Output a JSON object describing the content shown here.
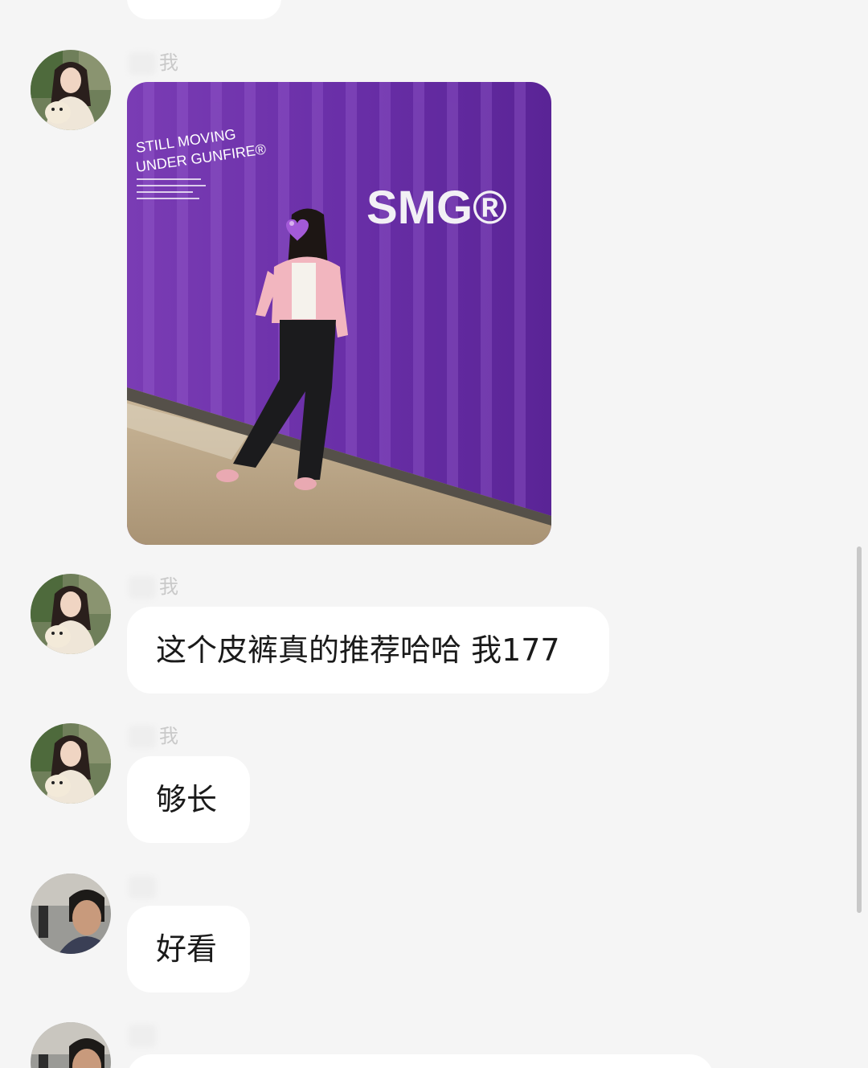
{
  "messages": [
    {
      "type": "image",
      "sender_name_suffix": "我",
      "image": {
        "wall_text_line1": "STILL MOVING",
        "wall_text_line2": "UNDER GUNFIRE®",
        "brand": "SMG®",
        "face_sticker": "purple-heart-emoji"
      }
    },
    {
      "type": "text",
      "sender_name_suffix": "我",
      "text": "这个皮裤真的推荐哈哈 我177"
    },
    {
      "type": "text",
      "sender_name_suffix": "我",
      "text": "够长"
    },
    {
      "type": "text",
      "sender_name_suffix": "",
      "text": "好看"
    },
    {
      "type": "text",
      "sender_name_suffix": "",
      "text": ""
    }
  ],
  "colors": {
    "background": "#f5f5f5",
    "bubble": "#ffffff",
    "text": "#1a1a1a",
    "wall_purple": "#6a2fa8"
  }
}
